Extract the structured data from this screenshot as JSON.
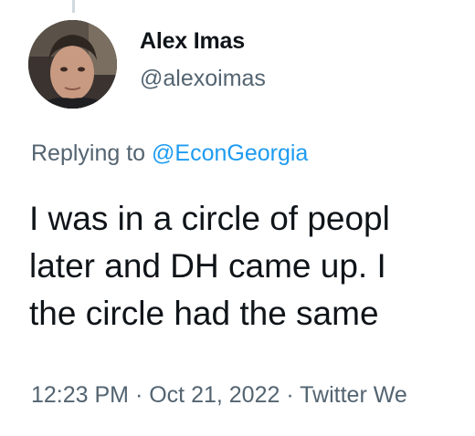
{
  "tweet": {
    "author": {
      "name": "Alex Imas",
      "handle": "@alexoimas",
      "avatar_icon": "profile-photo"
    },
    "reply_to": {
      "prefix": "Replying to",
      "mention": "@EconGeorgia"
    },
    "text_lines": [
      "I was in a circle of peopl",
      "later and DH came up. I",
      "the circle had the same"
    ],
    "meta": {
      "time": "12:23 PM",
      "separator_1": " · ",
      "date": "Oct 21, 2022",
      "separator_2": " · ",
      "source": "Twitter We"
    }
  },
  "colors": {
    "text_primary": "#0f1419",
    "text_secondary": "#536471",
    "link": "#1d9bf0",
    "thread_line": "#cfd9de"
  }
}
